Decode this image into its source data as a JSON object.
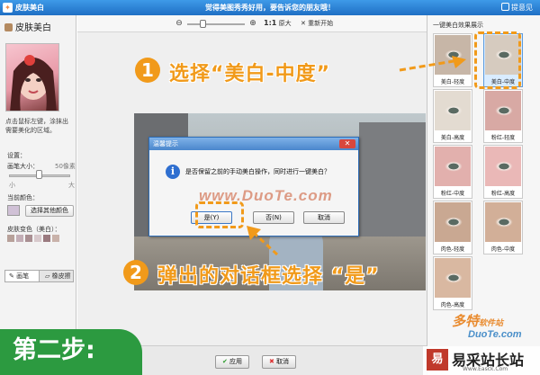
{
  "titlebar": {
    "title": "皮肤美白",
    "tip": "觉得美图秀秀好用，要告诉您的朋友哦！",
    "help": "提意见"
  },
  "sidebar": {
    "heading": "皮肤美白",
    "hint": "点击鼠标左键，涂抹出需要美化的区域。",
    "settings_label": "设置：",
    "brush_size_label": "画笔大小：",
    "brush_size_value": "50像素",
    "min_label": "小",
    "max_label": "大",
    "current_color_label": "当前颜色：",
    "other_color_button": "选择其他颜色",
    "skin_color_label": "皮肤变色（美白）：",
    "chips": [
      "#b7a19a",
      "#c3aeb6",
      "#a98f92",
      "#d8c9cc",
      "#9a7a7f",
      "#c9b2aa"
    ],
    "pen_tool": "画笔",
    "eraser_tool": "橡皮擦"
  },
  "toolbar": {
    "zoom_out": "⊖",
    "zoom_in": "⊕",
    "actual_size": "1:1",
    "actual_size_text": "原大",
    "reset": "重新开始"
  },
  "dialog": {
    "title": "温馨提示",
    "message": "是否保留之前的手动美白操作，同时进行一键美白？",
    "yes": "是(Y)",
    "no": "否(N)",
    "cancel": "取消"
  },
  "watermark": "www.DuoTe.com",
  "bottom": {
    "apply": "应用",
    "cancel": "取消"
  },
  "effects_panel": {
    "title": "一键美白效果展示",
    "items": [
      {
        "label": "美白-轻度",
        "tone": "#c7b6a7"
      },
      {
        "label": "美白-中度",
        "tone": "#d6cbbf"
      },
      {
        "label": "美白-高度",
        "tone": "#e3dbd1"
      },
      {
        "label": "粉红-轻度",
        "tone": "#d8a9a4"
      },
      {
        "label": "粉红-中度",
        "tone": "#e2b0ad"
      },
      {
        "label": "粉红-高度",
        "tone": "#eab8b7"
      },
      {
        "label": "肉色-轻度",
        "tone": "#c9a892"
      },
      {
        "label": "肉色-中度",
        "tone": "#d2af98"
      },
      {
        "label": "肉色-高度",
        "tone": "#d9b8a1"
      }
    ]
  },
  "annotations": {
    "step1_num": "1",
    "step1_text": "选择“美白-中度”",
    "step2_num": "2",
    "step2_text": "弹出的对话框选择 “是”",
    "step_label": "第二步:"
  },
  "logos": {
    "duote": "多特",
    "duote_small": "软件站",
    "duote_url": "DuoTe.com",
    "yicai": "易采站长站",
    "yicai_url": "Www.Easck.Com"
  },
  "colors": {
    "accent_orange": "#f19a1a",
    "step_green": "#2c9a40",
    "title_blue": "#1f6fc4"
  }
}
